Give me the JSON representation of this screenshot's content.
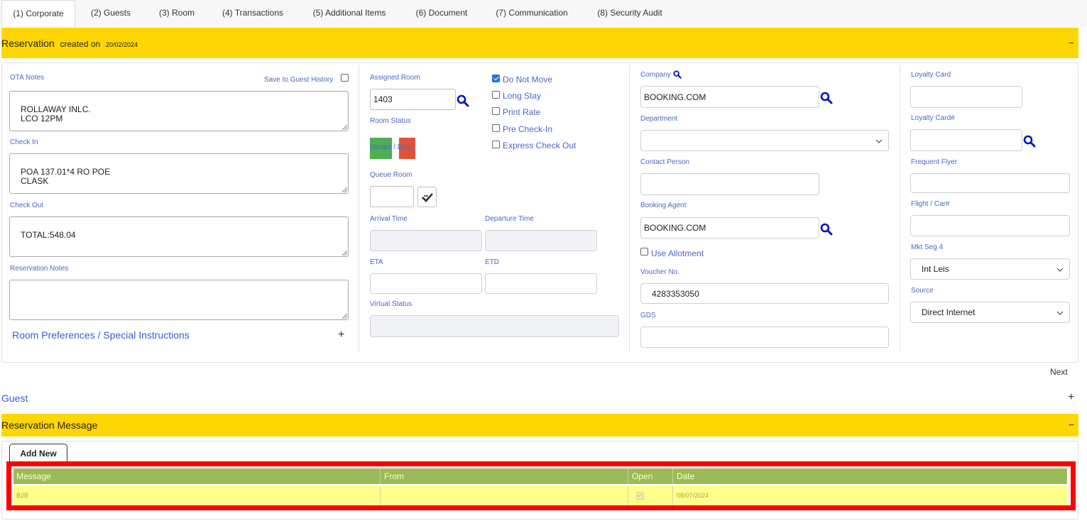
{
  "tabs": [
    {
      "label": "(1) Corporate"
    },
    {
      "label": "(2) Guests"
    },
    {
      "label": "(3) Room"
    },
    {
      "label": "(4) Transactions"
    },
    {
      "label": "(5) Additional Items"
    },
    {
      "label": "(6) Document"
    },
    {
      "label": "(7) Communication"
    },
    {
      "label": "(8) Security Audit"
    }
  ],
  "reservation": {
    "title": "Reservation",
    "created_label": "created on",
    "created_date": "20/02/2024",
    "collapse": "−"
  },
  "notes": {
    "ota_label": "OTA Notes",
    "save_history_label": "Save to Guest History",
    "ota_value": "ROLLAWAY INLC.\nLCO 12PM",
    "checkin_label": "Check In",
    "checkin_value": "POA 137.01*4 RO POE\nCLASK",
    "checkout_label": "Check Out",
    "checkout_value": "TOTAL:548.04",
    "res_notes_label": "Reservation Notes",
    "res_notes_value": "",
    "room_pref_label": "Room Preferences / Special Instructions",
    "room_pref_expand": "+"
  },
  "room": {
    "assigned_label": "Assigned Room",
    "assigned_value": "1403",
    "status_label": "Room Status",
    "status_vacant": "Vacant",
    "status_sep": "/",
    "status_dirty": "Dirty",
    "queue_label": "Queue Room",
    "arrival_label": "Arrival Time",
    "departure_label": "Departure Time",
    "eta_label": "ETA",
    "etd_label": "ETD",
    "virtual_label": "Virtual Status",
    "colors": {
      "vacant": "#4caf50",
      "dirty": "#e0533a"
    }
  },
  "options": {
    "do_not_move": "Do Not Move",
    "long_stay": "Long Stay",
    "print_rate": "Print Rate",
    "pre_checkin": "Pre Check-In",
    "express_checkout": "Express Check Out"
  },
  "company": {
    "company_label": "Company",
    "company_value": "BOOKING.COM",
    "department_label": "Department",
    "department_value": "",
    "contact_label": "Contact Person",
    "booking_agent_label": "Booking Agent",
    "booking_agent_value": "BOOKING.COM",
    "use_allotment": "Use Allotment",
    "voucher_label": "Voucher No.",
    "voucher_value": "4283353050",
    "gds_label": "GDS"
  },
  "loyalty": {
    "card_label": "Loyalty Card",
    "card_num_label": "Loyalty Card#",
    "frequent_flyer_label": "Frequent Flyer",
    "flight_label": "Flight / Car#",
    "mkt_seg_label": "Mkt Seg 4",
    "mkt_seg_value": "Int Leis",
    "source_label": "Source",
    "source_value": "Direct Internet"
  },
  "next_label": "Next",
  "guest": {
    "title": "Guest",
    "expand": "+"
  },
  "res_message": {
    "title": "Reservation Message",
    "collapse": "−",
    "add_new": "Add New",
    "columns": [
      "Message",
      "From",
      "Open",
      "Date"
    ],
    "rows": [
      {
        "message": "B2B",
        "from": "",
        "open": true,
        "date": "08/07/2024"
      }
    ]
  },
  "colors": {
    "section_header": "#ffd700",
    "label_blue": "#4a67c6",
    "table_header": "#9bbb59",
    "table_row": "#ffff8c",
    "highlight_border": "#ff0000"
  }
}
